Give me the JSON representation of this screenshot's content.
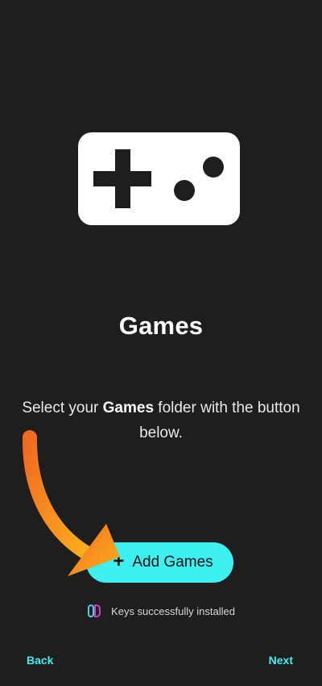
{
  "page": {
    "title": "Games",
    "description_prefix": "Select your ",
    "description_bold": "Games",
    "description_suffix": " folder with the button below."
  },
  "actions": {
    "add_button_icon": "+",
    "add_button_label": "Add Games"
  },
  "status": {
    "icon": "switch-controller-icon",
    "text": "Keys successfully installed"
  },
  "navigation": {
    "back_label": "Back",
    "next_label": "Next"
  },
  "colors": {
    "background": "#1f1e1f",
    "accent": "#3ff0f0",
    "arrow_start": "#f06b21",
    "arrow_end": "#ffb21d",
    "switch_left": "#3fd7e5",
    "switch_right": "#d23bc4"
  },
  "icons": {
    "hero": "gamepad-icon",
    "annotation": "arrow-pointer-icon"
  }
}
